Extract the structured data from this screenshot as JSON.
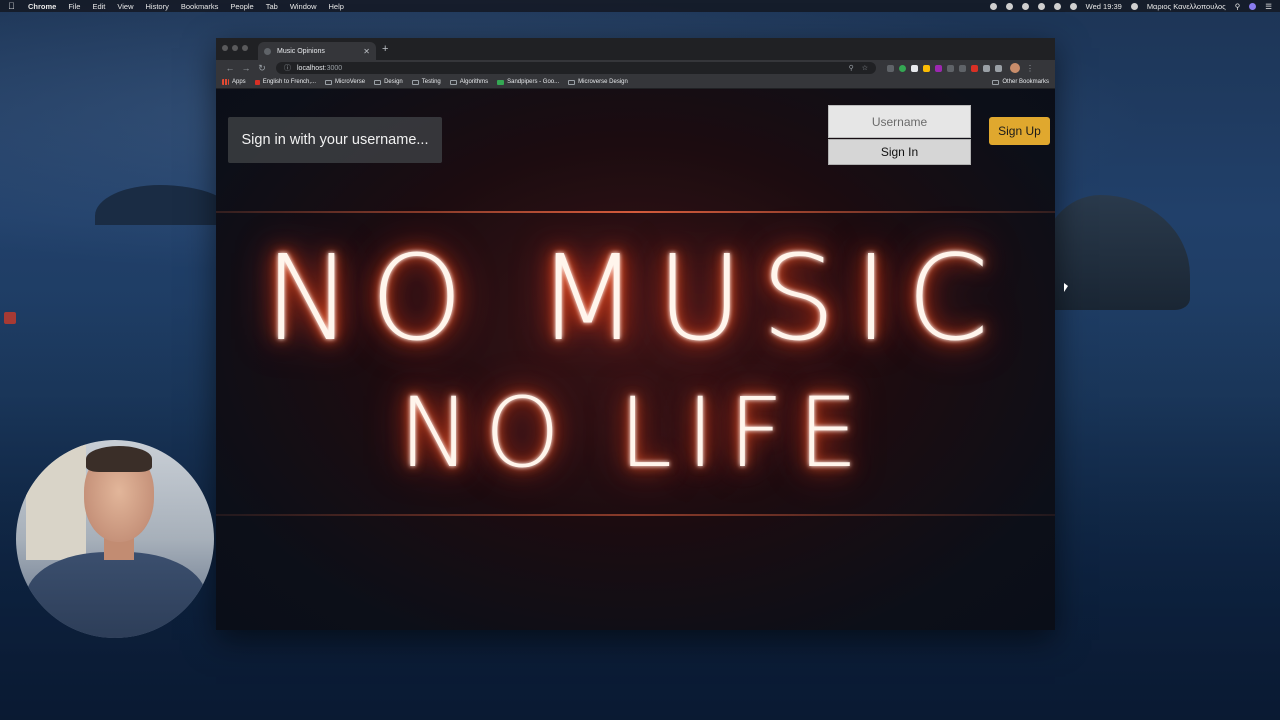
{
  "menubar": {
    "app": "Chrome",
    "items": [
      "File",
      "Edit",
      "View",
      "History",
      "Bookmarks",
      "People",
      "Tab",
      "Window",
      "Help"
    ],
    "clock": "Wed 19:39",
    "user": "Μαριος Κανελλοπουλος"
  },
  "browser": {
    "tab_title": "Music Opinions",
    "url_host": "localhost",
    "url_port": ":3000",
    "bookmarks": [
      "Apps",
      "English to French,...",
      "MicroVerse",
      "Design",
      "Testing",
      "Algorithms",
      "Sandpipers - Goo...",
      "Microverse Design"
    ],
    "other_bookmarks": "Other Bookmarks"
  },
  "page": {
    "signin_prompt": "Sign in with your username...",
    "username_placeholder": "Username",
    "signin_label": "Sign In",
    "signup_label": "Sign Up",
    "hero_line1": "NO MUSIC",
    "hero_line2": "NO LIFE"
  },
  "colors": {
    "signup_accent": "#e0a82e",
    "neon_glow": "#ff3d00"
  }
}
